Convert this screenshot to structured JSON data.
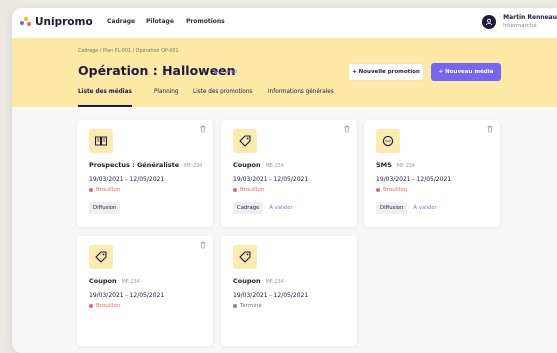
{
  "app": {
    "brand": "Unipromo",
    "colors": {
      "accent": "#7767ef",
      "header_bg": "#fde8a6",
      "brand_dark": "#1d1a3a",
      "status_red": "#e06a6a",
      "status_grey": "#8a8897"
    }
  },
  "nav": {
    "items": [
      {
        "label": "Cadrage"
      },
      {
        "label": "Pilotage"
      },
      {
        "label": "Promotions"
      }
    ]
  },
  "user": {
    "name": "Martin Renneau",
    "org": "Intermarché",
    "icon": "user-icon"
  },
  "header": {
    "breadcrumb": "Cadrage  /  Plan PL-001  /  Opération OP-001",
    "title": "Opération : Halloween",
    "status": "À venir",
    "secondary_button": "+ Nouvelle promotion",
    "primary_button": "+ Nouveau média",
    "tabs": [
      {
        "label": "Liste des médias",
        "active": true
      },
      {
        "label": "Planning",
        "active": false
      },
      {
        "label": "Liste des promotions",
        "active": false
      },
      {
        "label": "Informations générales",
        "active": false
      }
    ]
  },
  "cards": [
    {
      "icon": "book-icon",
      "title": "Prospectus : Généraliste",
      "code": "ME-234",
      "dates": "19/03/2021 - 12/05/2021",
      "status": "Brouillon",
      "status_color": "#e06a6a",
      "tag": "Diffusion",
      "link": ""
    },
    {
      "icon": "tag-icon",
      "title": "Coupon",
      "code": "ME-234",
      "dates": "19/03/2021 - 12/05/2021",
      "status": "Brouillon",
      "status_color": "#e06a6a",
      "tag": "Cadrage",
      "link": "À valider"
    },
    {
      "icon": "sms-icon",
      "title": "SMS",
      "code": "ME-234",
      "dates": "19/03/2021 - 12/05/2021",
      "status": "Brouillon",
      "status_color": "#e06a6a",
      "tag": "Diffusion",
      "link": "À valider"
    },
    {
      "icon": "tag-icon",
      "title": "Coupon",
      "code": "ME-234",
      "dates": "19/03/2021 - 12/05/2021",
      "status": "Brouillon",
      "status_color": "#e06a6a",
      "tag": "",
      "link": ""
    },
    {
      "icon": "tag-icon",
      "title": "Coupon",
      "code": "ME-234",
      "dates": "19/03/2021 - 12/05/2021",
      "status": "Terminé",
      "status_color": "#8a8897",
      "tag": "",
      "link": ""
    }
  ]
}
